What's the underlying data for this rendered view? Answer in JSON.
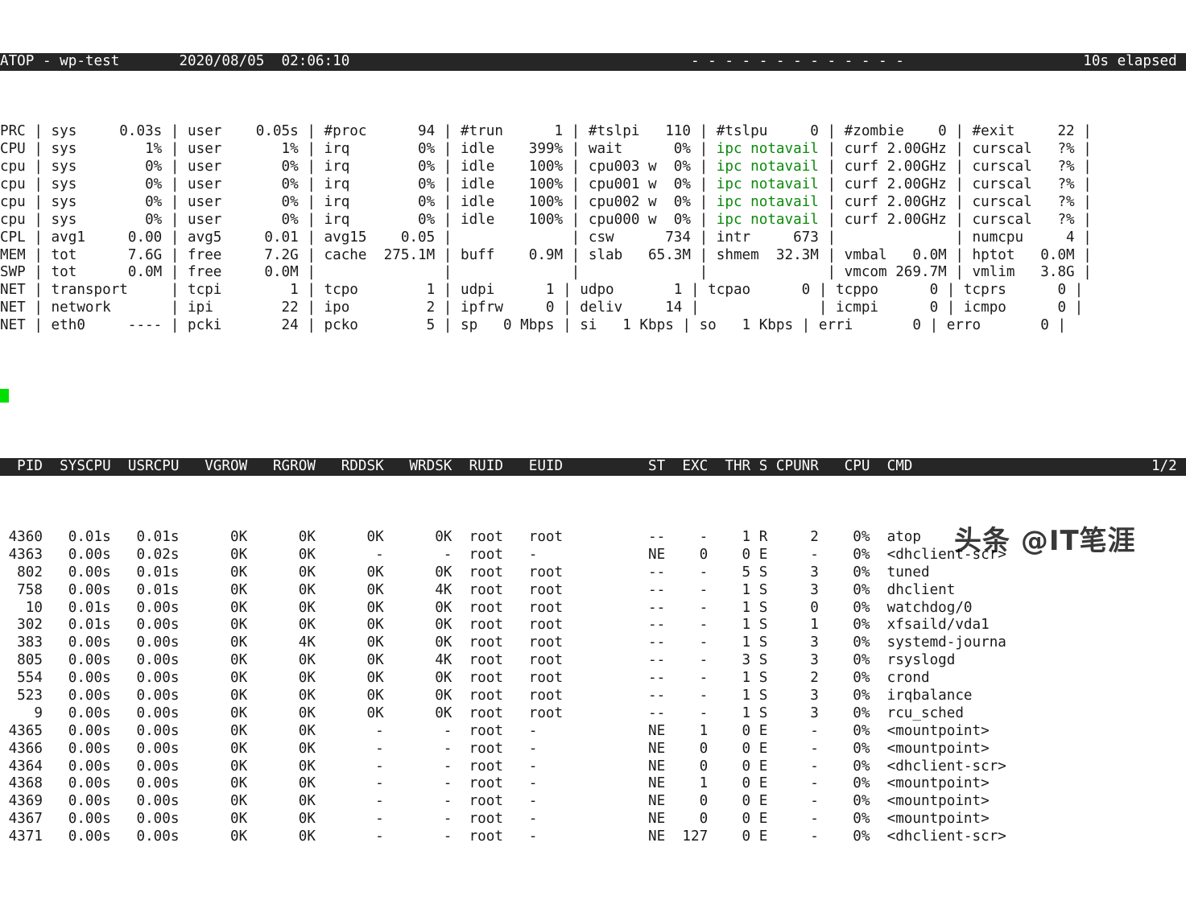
{
  "app": {
    "name": "ATOP",
    "title_line": "ATOP - wp-test",
    "hostname": "wp-test",
    "date": "2020/08/05",
    "time": "02:06:10",
    "separator": "- - - - - - - - - - - - -",
    "elapsed": "10s elapsed"
  },
  "colors": {
    "background": "#ffffff",
    "foreground": "#1a1a1a",
    "inverse_background": "#262626",
    "inverse_foreground": "#ffffff",
    "green": "#0b8a0b",
    "cursor": "#00e000"
  },
  "sys_rows": [
    {
      "label": "PRC",
      "cells": [
        {
          "name": "sys",
          "value": "0.03s"
        },
        {
          "name": "user",
          "value": "0.05s"
        },
        {
          "name": "#proc",
          "value": "94"
        },
        {
          "name": "#trun",
          "value": "1"
        },
        {
          "name": "#tslpi",
          "value": "110"
        },
        {
          "name": "#tslpu",
          "value": "0"
        },
        {
          "name": "#zombie",
          "value": "0"
        },
        {
          "name": "#exit",
          "value": "22"
        }
      ]
    },
    {
      "label": "CPU",
      "cells": [
        {
          "name": "sys",
          "value": "1%"
        },
        {
          "name": "user",
          "value": "1%"
        },
        {
          "name": "irq",
          "value": "0%"
        },
        {
          "name": "idle",
          "value": "399%"
        },
        {
          "name": "wait",
          "value": "0%"
        },
        {
          "name": "ipc notavail",
          "value": "",
          "green": true
        },
        {
          "name": "curf",
          "value": "2.00GHz"
        },
        {
          "name": "curscal",
          "value": "?%"
        }
      ]
    },
    {
      "label": "cpu",
      "cells": [
        {
          "name": "sys",
          "value": "0%"
        },
        {
          "name": "user",
          "value": "0%"
        },
        {
          "name": "irq",
          "value": "0%"
        },
        {
          "name": "idle",
          "value": "100%"
        },
        {
          "name": "cpu003 w",
          "value": "0%"
        },
        {
          "name": "ipc notavail",
          "value": "",
          "green": true
        },
        {
          "name": "curf",
          "value": "2.00GHz"
        },
        {
          "name": "curscal",
          "value": "?%"
        }
      ]
    },
    {
      "label": "cpu",
      "cells": [
        {
          "name": "sys",
          "value": "0%"
        },
        {
          "name": "user",
          "value": "0%"
        },
        {
          "name": "irq",
          "value": "0%"
        },
        {
          "name": "idle",
          "value": "100%"
        },
        {
          "name": "cpu001 w",
          "value": "0%"
        },
        {
          "name": "ipc notavail",
          "value": "",
          "green": true
        },
        {
          "name": "curf",
          "value": "2.00GHz"
        },
        {
          "name": "curscal",
          "value": "?%"
        }
      ]
    },
    {
      "label": "cpu",
      "cells": [
        {
          "name": "sys",
          "value": "0%"
        },
        {
          "name": "user",
          "value": "0%"
        },
        {
          "name": "irq",
          "value": "0%"
        },
        {
          "name": "idle",
          "value": "100%"
        },
        {
          "name": "cpu002 w",
          "value": "0%"
        },
        {
          "name": "ipc notavail",
          "value": "",
          "green": true
        },
        {
          "name": "curf",
          "value": "2.00GHz"
        },
        {
          "name": "curscal",
          "value": "?%"
        }
      ]
    },
    {
      "label": "cpu",
      "cells": [
        {
          "name": "sys",
          "value": "0%"
        },
        {
          "name": "user",
          "value": "0%"
        },
        {
          "name": "irq",
          "value": "0%"
        },
        {
          "name": "idle",
          "value": "100%"
        },
        {
          "name": "cpu000 w",
          "value": "0%"
        },
        {
          "name": "ipc notavail",
          "value": "",
          "green": true
        },
        {
          "name": "curf",
          "value": "2.00GHz"
        },
        {
          "name": "curscal",
          "value": "?%"
        }
      ]
    },
    {
      "label": "CPL",
      "cells": [
        {
          "name": "avg1",
          "value": "0.00"
        },
        {
          "name": "avg5",
          "value": "0.01"
        },
        {
          "name": "avg15",
          "value": "0.05"
        },
        {
          "name": "",
          "value": ""
        },
        {
          "name": "csw",
          "value": "734"
        },
        {
          "name": "intr",
          "value": "673"
        },
        {
          "name": "",
          "value": ""
        },
        {
          "name": "numcpu",
          "value": "4"
        }
      ]
    },
    {
      "label": "MEM",
      "cells": [
        {
          "name": "tot",
          "value": "7.6G"
        },
        {
          "name": "free",
          "value": "7.2G"
        },
        {
          "name": "cache",
          "value": "275.1M"
        },
        {
          "name": "buff",
          "value": "0.9M"
        },
        {
          "name": "slab",
          "value": "65.3M"
        },
        {
          "name": "shmem",
          "value": "32.3M"
        },
        {
          "name": "vmbal",
          "value": "0.0M"
        },
        {
          "name": "hptot",
          "value": "0.0M"
        }
      ]
    },
    {
      "label": "SWP",
      "cells": [
        {
          "name": "tot",
          "value": "0.0M"
        },
        {
          "name": "free",
          "value": "0.0M"
        },
        {
          "name": "",
          "value": ""
        },
        {
          "name": "",
          "value": ""
        },
        {
          "name": "",
          "value": ""
        },
        {
          "name": "",
          "value": ""
        },
        {
          "name": "vmcom",
          "value": "269.7M"
        },
        {
          "name": "vmlim",
          "value": "3.8G"
        }
      ]
    },
    {
      "label": "NET",
      "cells": [
        {
          "name": "transport",
          "value": ""
        },
        {
          "name": "tcpi",
          "value": "1"
        },
        {
          "name": "tcpo",
          "value": "1"
        },
        {
          "name": "udpi",
          "value": "1"
        },
        {
          "name": "udpo",
          "value": "1"
        },
        {
          "name": "tcpao",
          "value": "0"
        },
        {
          "name": "tcppo",
          "value": "0"
        },
        {
          "name": "tcprs",
          "value": "0"
        }
      ]
    },
    {
      "label": "NET",
      "cells": [
        {
          "name": "network",
          "value": ""
        },
        {
          "name": "ipi",
          "value": "22"
        },
        {
          "name": "ipo",
          "value": "2"
        },
        {
          "name": "ipfrw",
          "value": "0"
        },
        {
          "name": "deliv",
          "value": "14"
        },
        {
          "name": "",
          "value": ""
        },
        {
          "name": "icmpi",
          "value": "0"
        },
        {
          "name": "icmpo",
          "value": "0"
        }
      ]
    },
    {
      "label": "NET",
      "cells": [
        {
          "name": "eth0",
          "value": "----"
        },
        {
          "name": "pcki",
          "value": "24"
        },
        {
          "name": "pcko",
          "value": "5"
        },
        {
          "name": "sp",
          "value": "0 Mbps"
        },
        {
          "name": "si",
          "value": "1 Kbps"
        },
        {
          "name": "so",
          "value": "1 Kbps"
        },
        {
          "name": "erri",
          "value": "0"
        },
        {
          "name": "erro",
          "value": "0"
        }
      ]
    }
  ],
  "sys_lines": [
    "PRC | sys     0.03s | user    0.05s | #proc      94 | #trun      1 | #tslpi   110 | #tslpu     0 | #zombie    0 | #exit     22 |",
    "CPU | sys        1% | user       1% | irq        0% | idle    399% | wait      0% | @GREEN@ | curf 2.00GHz | curscal   ?% |",
    "cpu | sys        0% | user       0% | irq        0% | idle    100% | cpu003 w  0% | @GREEN@ | curf 2.00GHz | curscal   ?% |",
    "cpu | sys        0% | user       0% | irq        0% | idle    100% | cpu001 w  0% | @GREEN@ | curf 2.00GHz | curscal   ?% |",
    "cpu | sys        0% | user       0% | irq        0% | idle    100% | cpu002 w  0% | @GREEN@ | curf 2.00GHz | curscal   ?% |",
    "cpu | sys        0% | user       0% | irq        0% | idle    100% | cpu000 w  0% | @GREEN@ | curf 2.00GHz | curscal   ?% |",
    "CPL | avg1     0.00 | avg5     0.01 | avg15    0.05 |              | csw      734 | intr     673 |              | numcpu     4 |",
    "MEM | tot      7.6G | free     7.2G | cache  275.1M | buff    0.9M | slab   65.3M | shmem  32.3M | vmbal   0.0M | hptot   0.0M |",
    "SWP | tot      0.0M | free     0.0M |               |              |              |              | vmcom 269.7M | vmlim   3.8G |",
    "NET | transport     | tcpi        1 | tcpo        1 | udpi      1 | udpo       1 | tcpao      0 | tcppo      0 | tcprs      0 |",
    "NET | network       | ipi        22 | ipo         2 | ipfrw     0 | deliv     14 |              | icmpi      0 | icmpo      0 |",
    "NET | eth0     ---- | pcki       24 | pcko        5 | sp   0 Mbps | si   1 Kbps | so   1 Kbps | erri       0 | erro       0 |"
  ],
  "process_table": {
    "columns": [
      "PID",
      "SYSCPU",
      "USRCPU",
      "VGROW",
      "RGROW",
      "RDDSK",
      "WRDSK",
      "RUID",
      "EUID",
      "ST",
      "EXC",
      "THR",
      "S",
      "CPUNR",
      "CPU",
      "CMD"
    ],
    "page_indicator": "1/2",
    "header_line": "  PID  SYSCPU  USRCPU   VGROW   RGROW   RDDSK   WRDSK   RUID       EUID       ST   EXC    THR  S   CPUNR   CPU  CMD          1/2",
    "rows": [
      {
        "pid": "4360",
        "syscpu": "0.01s",
        "usrcpu": "0.01s",
        "vgrow": "0K",
        "rgrow": "0K",
        "rddsk": "0K",
        "wrdsk": "0K",
        "ruid": "root",
        "euid": "root",
        "st": "--",
        "exc": "-",
        "thr": "1",
        "s": "R",
        "cpunr": "2",
        "cpu": "0%",
        "cmd": "atop"
      },
      {
        "pid": "4363",
        "syscpu": "0.00s",
        "usrcpu": "0.02s",
        "vgrow": "0K",
        "rgrow": "0K",
        "rddsk": "-",
        "wrdsk": "-",
        "ruid": "root",
        "euid": "-",
        "st": "NE",
        "exc": "0",
        "thr": "0",
        "s": "E",
        "cpunr": "-",
        "cpu": "0%",
        "cmd": "<dhclient-scr>"
      },
      {
        "pid": "802",
        "syscpu": "0.00s",
        "usrcpu": "0.01s",
        "vgrow": "0K",
        "rgrow": "0K",
        "rddsk": "0K",
        "wrdsk": "0K",
        "ruid": "root",
        "euid": "root",
        "st": "--",
        "exc": "-",
        "thr": "5",
        "s": "S",
        "cpunr": "3",
        "cpu": "0%",
        "cmd": "tuned"
      },
      {
        "pid": "758",
        "syscpu": "0.00s",
        "usrcpu": "0.01s",
        "vgrow": "0K",
        "rgrow": "0K",
        "rddsk": "0K",
        "wrdsk": "4K",
        "ruid": "root",
        "euid": "root",
        "st": "--",
        "exc": "-",
        "thr": "1",
        "s": "S",
        "cpunr": "3",
        "cpu": "0%",
        "cmd": "dhclient"
      },
      {
        "pid": "10",
        "syscpu": "0.01s",
        "usrcpu": "0.00s",
        "vgrow": "0K",
        "rgrow": "0K",
        "rddsk": "0K",
        "wrdsk": "0K",
        "ruid": "root",
        "euid": "root",
        "st": "--",
        "exc": "-",
        "thr": "1",
        "s": "S",
        "cpunr": "0",
        "cpu": "0%",
        "cmd": "watchdog/0"
      },
      {
        "pid": "302",
        "syscpu": "0.01s",
        "usrcpu": "0.00s",
        "vgrow": "0K",
        "rgrow": "0K",
        "rddsk": "0K",
        "wrdsk": "0K",
        "ruid": "root",
        "euid": "root",
        "st": "--",
        "exc": "-",
        "thr": "1",
        "s": "S",
        "cpunr": "1",
        "cpu": "0%",
        "cmd": "xfsaild/vda1"
      },
      {
        "pid": "383",
        "syscpu": "0.00s",
        "usrcpu": "0.00s",
        "vgrow": "0K",
        "rgrow": "4K",
        "rddsk": "0K",
        "wrdsk": "0K",
        "ruid": "root",
        "euid": "root",
        "st": "--",
        "exc": "-",
        "thr": "1",
        "s": "S",
        "cpunr": "3",
        "cpu": "0%",
        "cmd": "systemd-journa"
      },
      {
        "pid": "805",
        "syscpu": "0.00s",
        "usrcpu": "0.00s",
        "vgrow": "0K",
        "rgrow": "0K",
        "rddsk": "0K",
        "wrdsk": "4K",
        "ruid": "root",
        "euid": "root",
        "st": "--",
        "exc": "-",
        "thr": "3",
        "s": "S",
        "cpunr": "3",
        "cpu": "0%",
        "cmd": "rsyslogd"
      },
      {
        "pid": "554",
        "syscpu": "0.00s",
        "usrcpu": "0.00s",
        "vgrow": "0K",
        "rgrow": "0K",
        "rddsk": "0K",
        "wrdsk": "0K",
        "ruid": "root",
        "euid": "root",
        "st": "--",
        "exc": "-",
        "thr": "1",
        "s": "S",
        "cpunr": "2",
        "cpu": "0%",
        "cmd": "crond"
      },
      {
        "pid": "523",
        "syscpu": "0.00s",
        "usrcpu": "0.00s",
        "vgrow": "0K",
        "rgrow": "0K",
        "rddsk": "0K",
        "wrdsk": "0K",
        "ruid": "root",
        "euid": "root",
        "st": "--",
        "exc": "-",
        "thr": "1",
        "s": "S",
        "cpunr": "3",
        "cpu": "0%",
        "cmd": "irqbalance"
      },
      {
        "pid": "9",
        "syscpu": "0.00s",
        "usrcpu": "0.00s",
        "vgrow": "0K",
        "rgrow": "0K",
        "rddsk": "0K",
        "wrdsk": "0K",
        "ruid": "root",
        "euid": "root",
        "st": "--",
        "exc": "-",
        "thr": "1",
        "s": "S",
        "cpunr": "3",
        "cpu": "0%",
        "cmd": "rcu_sched"
      },
      {
        "pid": "4365",
        "syscpu": "0.00s",
        "usrcpu": "0.00s",
        "vgrow": "0K",
        "rgrow": "0K",
        "rddsk": "-",
        "wrdsk": "-",
        "ruid": "root",
        "euid": "-",
        "st": "NE",
        "exc": "1",
        "thr": "0",
        "s": "E",
        "cpunr": "-",
        "cpu": "0%",
        "cmd": "<mountpoint>"
      },
      {
        "pid": "4366",
        "syscpu": "0.00s",
        "usrcpu": "0.00s",
        "vgrow": "0K",
        "rgrow": "0K",
        "rddsk": "-",
        "wrdsk": "-",
        "ruid": "root",
        "euid": "-",
        "st": "NE",
        "exc": "0",
        "thr": "0",
        "s": "E",
        "cpunr": "-",
        "cpu": "0%",
        "cmd": "<mountpoint>"
      },
      {
        "pid": "4364",
        "syscpu": "0.00s",
        "usrcpu": "0.00s",
        "vgrow": "0K",
        "rgrow": "0K",
        "rddsk": "-",
        "wrdsk": "-",
        "ruid": "root",
        "euid": "-",
        "st": "NE",
        "exc": "0",
        "thr": "0",
        "s": "E",
        "cpunr": "-",
        "cpu": "0%",
        "cmd": "<dhclient-scr>"
      },
      {
        "pid": "4368",
        "syscpu": "0.00s",
        "usrcpu": "0.00s",
        "vgrow": "0K",
        "rgrow": "0K",
        "rddsk": "-",
        "wrdsk": "-",
        "ruid": "root",
        "euid": "-",
        "st": "NE",
        "exc": "1",
        "thr": "0",
        "s": "E",
        "cpunr": "-",
        "cpu": "0%",
        "cmd": "<mountpoint>"
      },
      {
        "pid": "4369",
        "syscpu": "0.00s",
        "usrcpu": "0.00s",
        "vgrow": "0K",
        "rgrow": "0K",
        "rddsk": "-",
        "wrdsk": "-",
        "ruid": "root",
        "euid": "-",
        "st": "NE",
        "exc": "0",
        "thr": "0",
        "s": "E",
        "cpunr": "-",
        "cpu": "0%",
        "cmd": "<mountpoint>"
      },
      {
        "pid": "4367",
        "syscpu": "0.00s",
        "usrcpu": "0.00s",
        "vgrow": "0K",
        "rgrow": "0K",
        "rddsk": "-",
        "wrdsk": "-",
        "ruid": "root",
        "euid": "-",
        "st": "NE",
        "exc": "0",
        "thr": "0",
        "s": "E",
        "cpunr": "-",
        "cpu": "0%",
        "cmd": "<mountpoint>"
      },
      {
        "pid": "4371",
        "syscpu": "0.00s",
        "usrcpu": "0.00s",
        "vgrow": "0K",
        "rgrow": "0K",
        "rddsk": "-",
        "wrdsk": "-",
        "ruid": "root",
        "euid": "-",
        "st": "NE",
        "exc": "127",
        "thr": "0",
        "s": "E",
        "cpunr": "-",
        "cpu": "0%",
        "cmd": "<dhclient-scr>"
      }
    ]
  },
  "watermark": {
    "text": "头条 @IT笔涯"
  }
}
